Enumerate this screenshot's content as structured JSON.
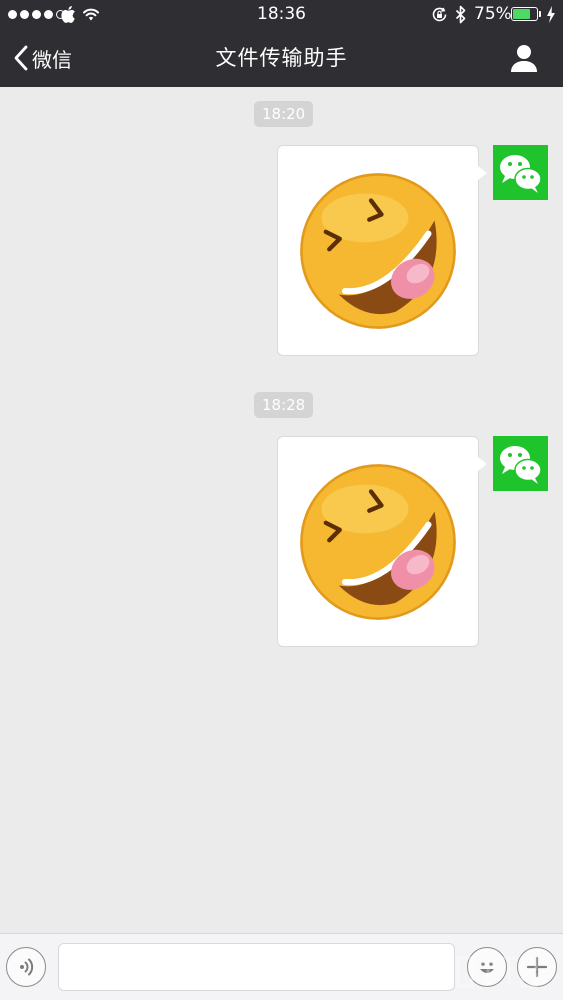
{
  "status_bar": {
    "time": "18:36",
    "battery": "75%",
    "battery_level": 0.75,
    "signal_bars_filled": 4,
    "signal_bars_total": 5,
    "icons": [
      "apple-icon",
      "wifi-icon",
      "orientation-lock-icon",
      "bluetooth-icon",
      "charging-bolt-icon"
    ]
  },
  "nav": {
    "back_label": "微信",
    "title": "文件传输助手",
    "right_icon": "person-icon"
  },
  "messages": [
    {
      "timestamp": "18:20",
      "content": "laughing-emoji-sticker",
      "sender_avatar": "wechat-logo-icon"
    },
    {
      "timestamp": "18:28",
      "content": "laughing-emoji-sticker",
      "sender_avatar": "wechat-logo-icon"
    }
  ],
  "input_bar": {
    "left_icon": "voice-icon",
    "text_value": "",
    "right_icons": [
      "emoji-icon",
      "plus-icon"
    ]
  },
  "colors": {
    "topbar": "#2e2e33",
    "chat_background": "#ebebeb",
    "wechat_green": "#1fc42c",
    "battery_green": "#4cd964"
  }
}
